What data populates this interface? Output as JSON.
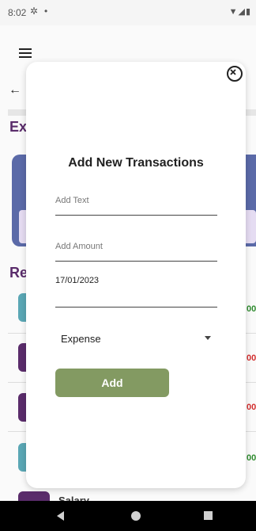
{
  "status_bar": {
    "time": "8:02",
    "gear_icon": "gear-icon",
    "dot": "•",
    "system_icons": "▼◢▮"
  },
  "background": {
    "section_title_1": "Ex",
    "section_title_2": "Re",
    "amount_tails": [
      {
        "text": "00",
        "color": "#2e8b2e"
      },
      {
        "text": "00",
        "color": "#d32f2f"
      },
      {
        "text": "00",
        "color": "#d32f2f"
      },
      {
        "text": "00",
        "color": "#2e8b2e"
      }
    ],
    "tile_colors": [
      "#5aa7b5",
      "#5a2c6b",
      "#5a2c6b",
      "#5aa7b5",
      "#5a2c6b"
    ],
    "last_tile_label": "Salary"
  },
  "dialog": {
    "title": "Add New Transactions",
    "text_placeholder": "Add Text",
    "amount_placeholder": "Add Amount",
    "date_value": "17/01/2023",
    "type_value": "Expense",
    "add_label": "Add"
  },
  "colors": {
    "accent_purple": "#5a2c6b",
    "add_button": "#839a62"
  }
}
